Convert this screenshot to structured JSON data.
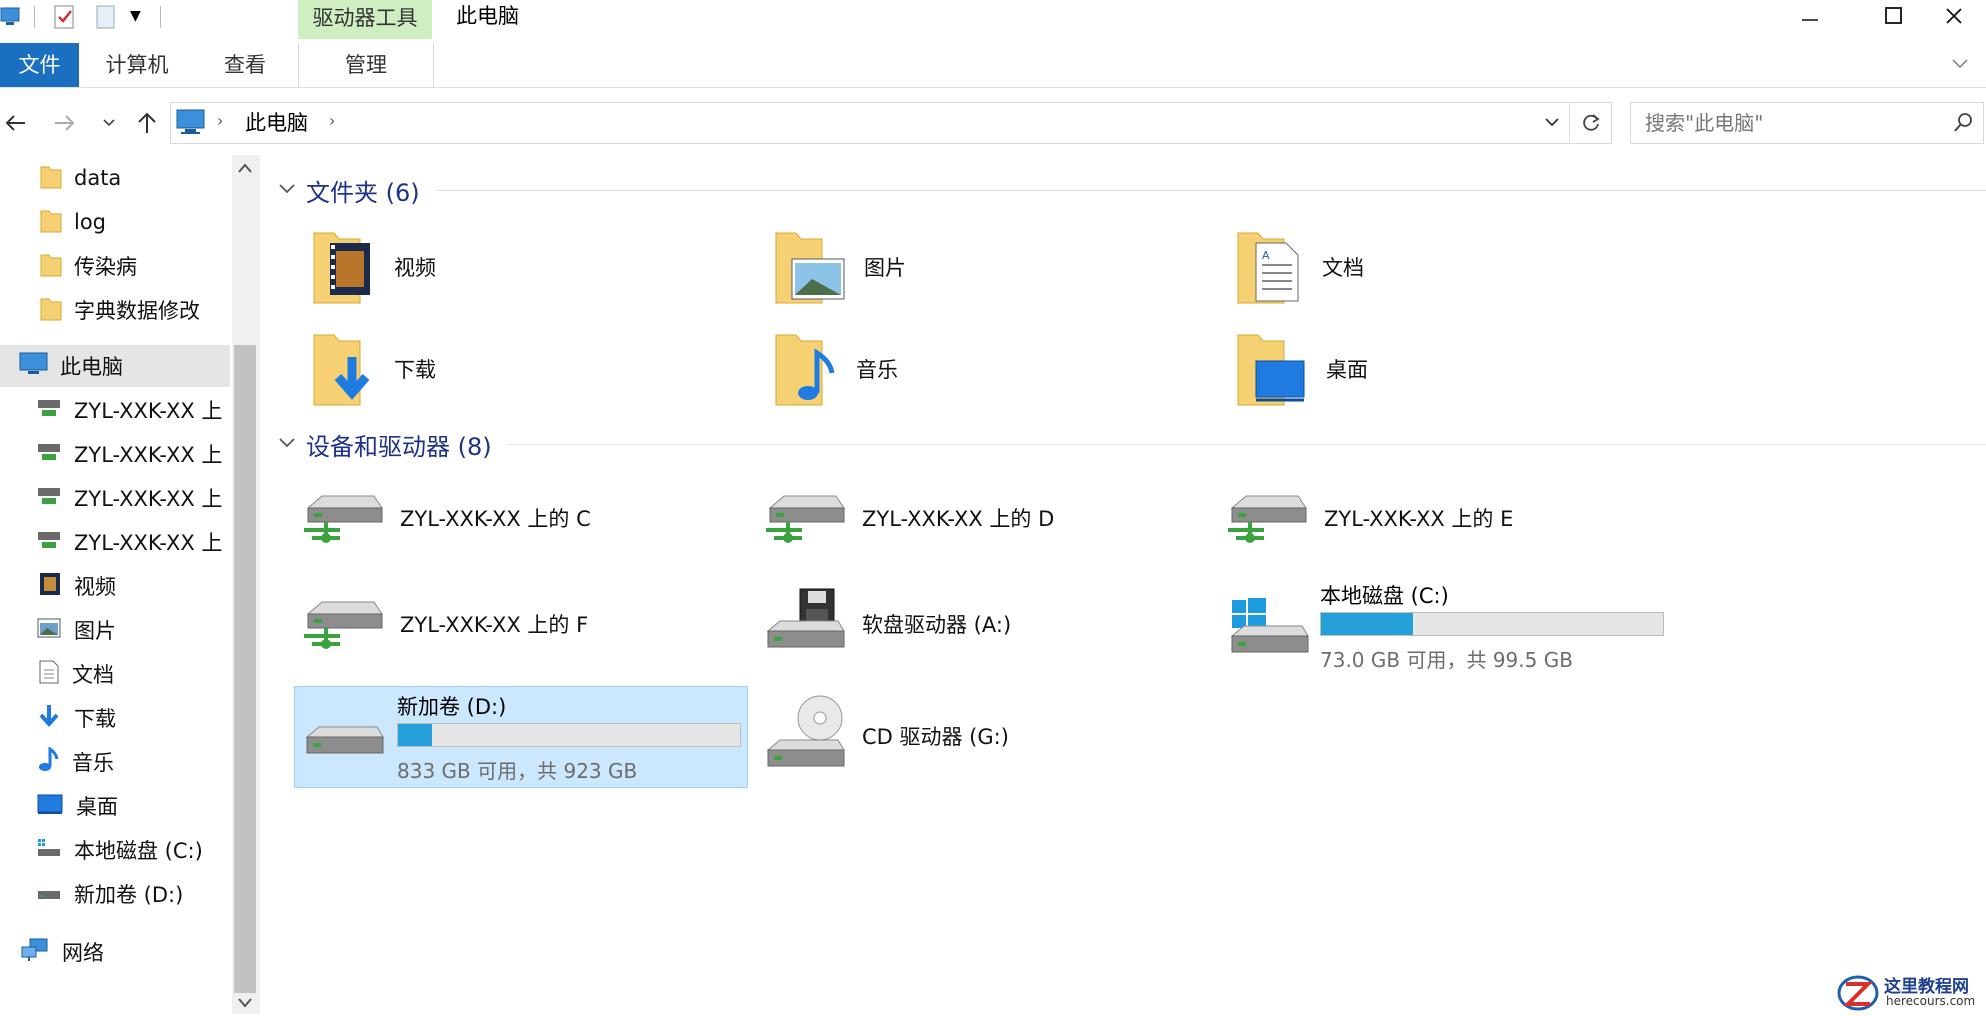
{
  "ribbon": {
    "context_tab": "驱动器工具",
    "window_title": "此电脑",
    "tabs": {
      "file": "文件",
      "computer": "计算机",
      "view": "查看",
      "manage": "管理"
    }
  },
  "address": {
    "location": "此电脑",
    "search_placeholder": "搜索\"此电脑\""
  },
  "sidebar": {
    "quick_access": [
      "data",
      "log",
      "传染病",
      "字典数据修改"
    ],
    "this_pc": "此电脑",
    "network_drives": [
      "ZYL-XXK-XX 上",
      "ZYL-XXK-XX 上",
      "ZYL-XXK-XX 上",
      "ZYL-XXK-XX 上"
    ],
    "libraries": [
      "视频",
      "图片",
      "文档",
      "下载",
      "音乐",
      "桌面"
    ],
    "local_drives": [
      "本地磁盘 (C:)",
      "新加卷 (D:)"
    ],
    "network": "网络"
  },
  "folders": {
    "header": "文件夹 (6)",
    "items": [
      "视频",
      "图片",
      "文档",
      "下载",
      "音乐",
      "桌面"
    ]
  },
  "devices": {
    "header": "设备和驱动器 (8)",
    "net_c": "ZYL-XXK-XX 上的 C",
    "net_d": "ZYL-XXK-XX 上的 D",
    "net_e": "ZYL-XXK-XX 上的 E",
    "net_f": "ZYL-XXK-XX 上的 F",
    "floppy": "软盘驱动器 (A:)",
    "cd": "CD 驱动器 (G:)",
    "drive_c": {
      "name": "本地磁盘 (C:)",
      "space": "73.0 GB 可用，共 99.5 GB",
      "used_fraction": 0.27
    },
    "drive_d": {
      "name": "新加卷 (D:)",
      "space": "833 GB 可用，共 923 GB",
      "used_fraction": 0.1
    }
  },
  "watermark": {
    "title": "这里教程网",
    "url": "herecours.com"
  },
  "colors": {
    "accent": "#1a6fc0",
    "bar_fill": "#26a0da",
    "group_title": "#1e3287",
    "selection": "#cce8ff"
  }
}
